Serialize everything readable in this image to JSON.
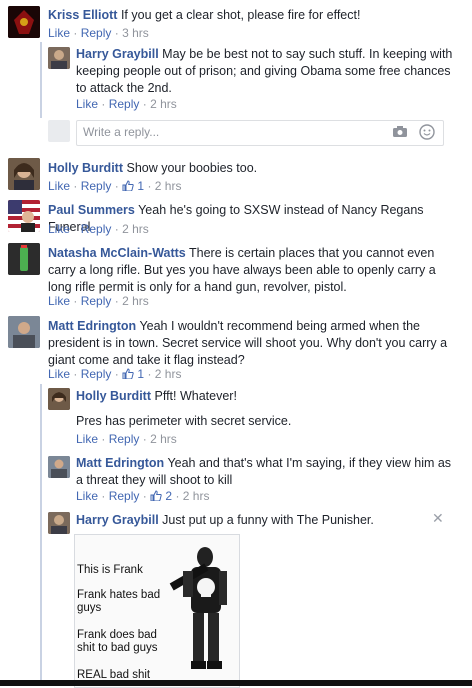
{
  "comments": [
    {
      "name": "Kriss Elliott",
      "text": "If you get a clear shot, please fire for effect!",
      "like": "Like",
      "reply": "Reply",
      "time": "3 hrs"
    },
    {
      "name": "Harry Graybill",
      "text": "May be be best not to say such stuff. In keeping with keeping people out of prison; and giving Obama some free chances to attack the 2nd.",
      "like": "Like",
      "reply": "Reply",
      "time": "2 hrs"
    },
    {
      "name": "Holly Burditt",
      "text": "Show your boobies too.",
      "like": "Like",
      "reply": "Reply",
      "likes": "1",
      "time": "2 hrs"
    },
    {
      "name": "Paul Summers",
      "text": "Yeah he's going to SXSW instead of Nancy Regans Funeral",
      "like": "Like",
      "reply": "Reply",
      "time": "2 hrs"
    },
    {
      "name": "Natasha McClain-Watts",
      "text": "There is certain places that you cannot even carry a long rifle. But yes you have always been able to openly carry a long rifle permit is only for a hand gun, revolver, pistol.",
      "like": "Like",
      "reply": "Reply",
      "time": "2 hrs"
    },
    {
      "name": "Matt Edrington",
      "text": "Yeah I wouldn't recommend being armed when the president is in town. Secret service will shoot you. Why don't you carry a giant come and take it flag instead?",
      "like": "Like",
      "reply": "Reply",
      "likes": "1",
      "time": "2 hrs"
    },
    {
      "name": "Holly Burditt",
      "text": "Pfft! Whatever!",
      "text2": "Pres has perimeter with secret service.",
      "like": "Like",
      "reply": "Reply",
      "time": "2 hrs"
    },
    {
      "name": "Matt Edrington",
      "text": "Yeah and that's what I'm saying, if they view him as a threat they will shoot to kill",
      "like": "Like",
      "reply": "Reply",
      "likes": "2",
      "time": "2 hrs"
    },
    {
      "name": "Harry Graybill",
      "text": "Just put up a funny with The Punisher."
    }
  ],
  "reply_box": {
    "placeholder": "Write a reply..."
  },
  "meme": {
    "line1": "This is Frank",
    "line2": "Frank hates bad guys",
    "line3": "Frank does bad shit to bad guys",
    "line4": "REAL bad shit"
  },
  "sep": "·",
  "icons": {
    "like": "thumbs-up-icon",
    "camera": "camera-icon",
    "emoji": "smiley-icon",
    "close": "close-icon"
  },
  "colors": {
    "name": "#365899",
    "link": "#4267b2",
    "meta": "#90949c",
    "thread": "#c9d2e3"
  }
}
